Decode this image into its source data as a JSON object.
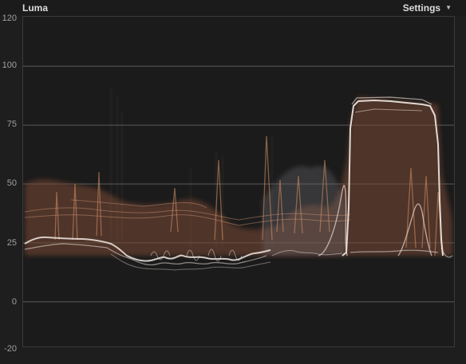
{
  "header": {
    "title": "Luma",
    "settings_label": "Settings",
    "settings_icon": "chevron-down-icon"
  },
  "scale": {
    "labels": [
      "120",
      "100",
      "75",
      "50",
      "25",
      "0",
      "-20"
    ],
    "values": [
      120,
      100,
      75,
      50,
      25,
      0,
      -20
    ],
    "gridlines": [
      100,
      75,
      50,
      25,
      0
    ]
  },
  "colors": {
    "background": "#1b1b1b",
    "gridline": "#5a5a5a",
    "trace_white": "#f0e8e2",
    "trace_warm": "#c98a63"
  }
}
